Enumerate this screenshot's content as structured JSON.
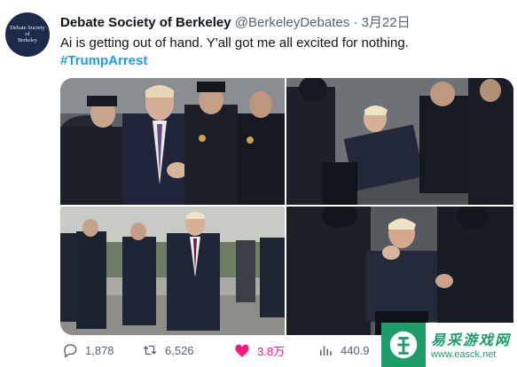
{
  "account": {
    "display_name": "Debate Society of Berkeley",
    "handle": "@BerkeleyDebates",
    "separator": "·",
    "date": "3月22日",
    "avatar_lines": [
      "Debate Society",
      "of",
      "Berkeley"
    ]
  },
  "tweet": {
    "text": "Ai is getting out of hand. Y'all got me all excited for nothing.",
    "hashtag": "#TrumpArrest"
  },
  "media": {
    "images": [
      {
        "subject": "man in suit held by police officers"
      },
      {
        "subject": "man in suit struggling with police officers"
      },
      {
        "subject": "man in suit running from police officers"
      },
      {
        "subject": "man in suit pinned by police officers"
      }
    ]
  },
  "actions": {
    "replies": "1,878",
    "retweets": "6,526",
    "likes": "3.8万",
    "views": "440.9"
  },
  "colors": {
    "accent": "#1d9bf0",
    "like": "#f91880",
    "muted": "#536471",
    "watermark": "#1e9c6a"
  },
  "icons": {
    "more": "more-icon",
    "reply": "reply-icon",
    "retweet": "retweet-icon",
    "like": "heart-icon",
    "views": "views-icon"
  },
  "watermark": {
    "chinese": "易采游戏网",
    "url": "www.easck.net"
  }
}
